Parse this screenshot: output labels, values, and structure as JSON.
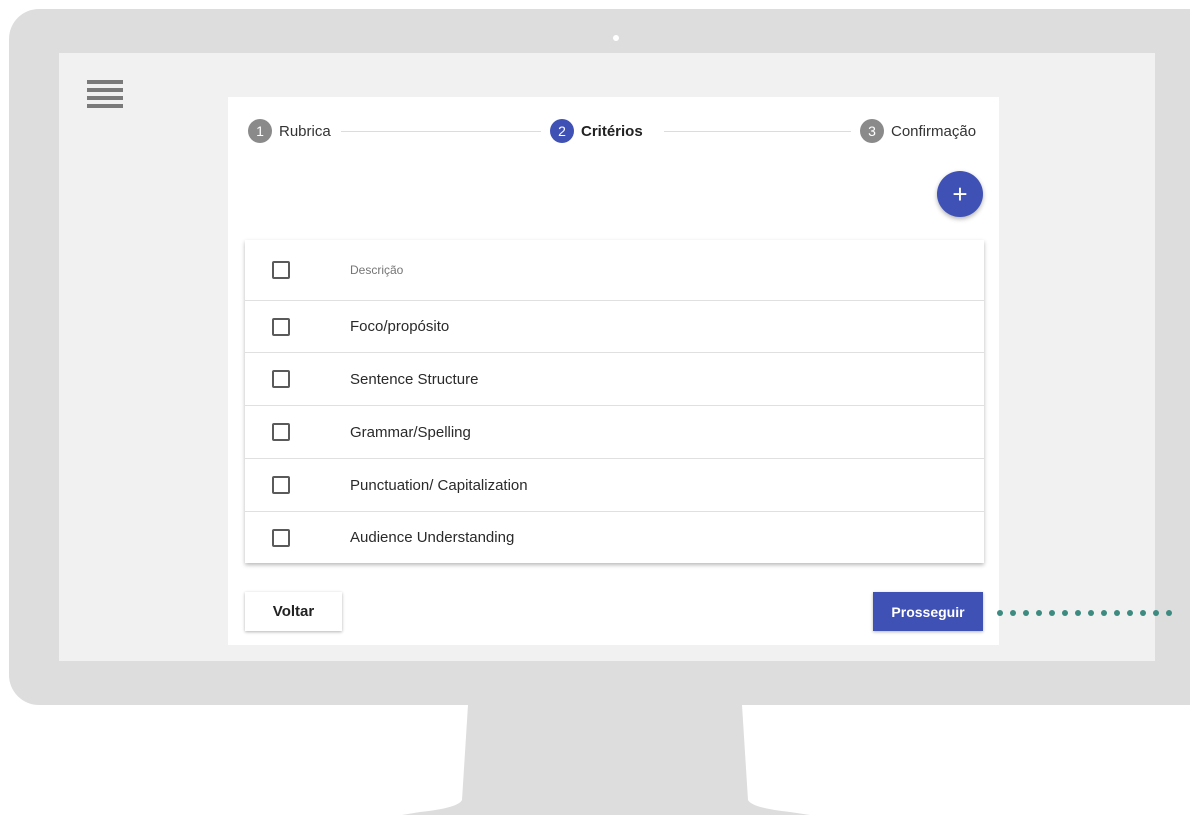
{
  "menu": {
    "icon": "hamburger-menu-icon"
  },
  "stepper": {
    "steps": [
      {
        "number": "1",
        "label": "Rubrica",
        "active": false
      },
      {
        "number": "2",
        "label": "Critérios",
        "active": true
      },
      {
        "number": "3",
        "label": "Confirmação",
        "active": false
      }
    ]
  },
  "fab": {
    "label": "+",
    "icon": "plus-icon"
  },
  "table": {
    "header": "Descrição",
    "rows": [
      "Foco/propósito",
      "Sentence Structure",
      "Grammar/Spelling",
      "Punctuation/ Capitalization",
      "Audience Understanding"
    ]
  },
  "actions": {
    "back_label": "Voltar",
    "next_label": "Prosseguir"
  },
  "colors": {
    "accent": "#3f51b5",
    "inactive_step": "#8a8a8a",
    "dotted_line": "#3c8a80",
    "bezel": "#dddddd",
    "screen_bg": "#f1f1f1"
  }
}
